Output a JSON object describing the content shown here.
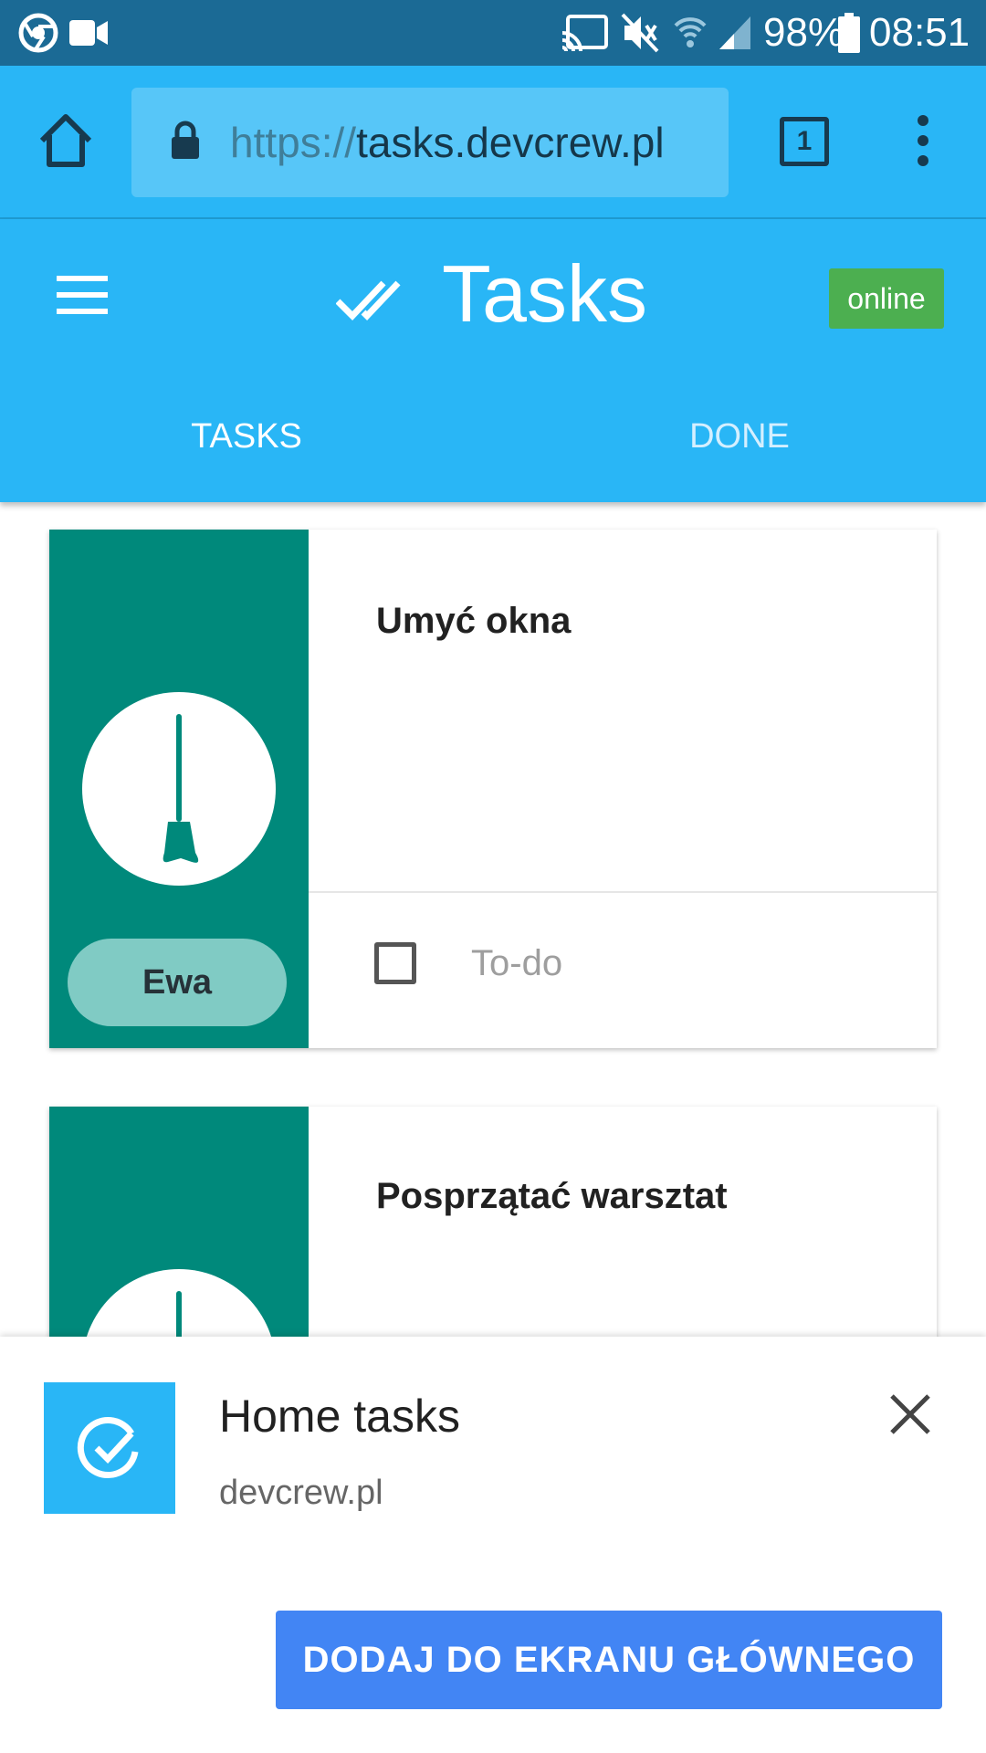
{
  "status_bar": {
    "battery": "98%",
    "time": "08:51"
  },
  "browser": {
    "url_scheme": "https://",
    "url_host": "tasks.devcrew.pl",
    "tab_count": "1"
  },
  "app": {
    "title": "Tasks",
    "status_badge": "online",
    "tabs": [
      {
        "label": "TASKS",
        "active": true
      },
      {
        "label": "DONE",
        "active": false
      }
    ]
  },
  "tasks": [
    {
      "title": "Umyć okna",
      "status": "To-do",
      "owner": "Ewa"
    },
    {
      "title": "Posprzątać warsztat"
    }
  ],
  "install_banner": {
    "app_name": "Home tasks",
    "domain": "devcrew.pl",
    "button_label": "DODAJ DO EKRANU GŁÓWNEGO"
  },
  "colors": {
    "primary": "#29b6f6",
    "status_bar": "#1b6a95",
    "card_accent": "#00897b",
    "online": "#4caf50",
    "button": "#4285f4"
  }
}
